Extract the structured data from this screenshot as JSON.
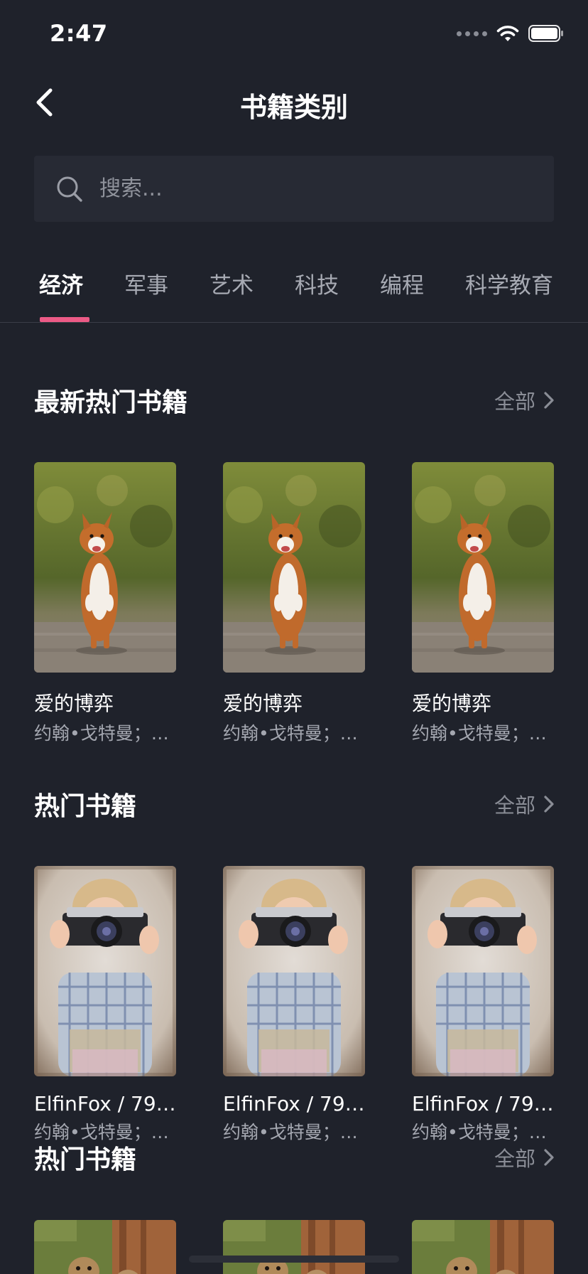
{
  "status_bar": {
    "time": "2:47"
  },
  "header": {
    "title": "书籍类别"
  },
  "search": {
    "placeholder": "搜索..."
  },
  "tabs": [
    {
      "label": "经济",
      "active": true
    },
    {
      "label": "军事",
      "active": false
    },
    {
      "label": "艺术",
      "active": false
    },
    {
      "label": "科技",
      "active": false
    },
    {
      "label": "编程",
      "active": false
    },
    {
      "label": "科学教育",
      "active": false
    }
  ],
  "sections": [
    {
      "title": "最新热门书籍",
      "see_all": "全部",
      "books": [
        {
          "title": "爱的博弈",
          "author": "约翰•戈特曼；娜...",
          "cover": "corgi-photo"
        },
        {
          "title": "爱的博弈",
          "author": "约翰•戈特曼；娜...",
          "cover": "corgi-photo"
        },
        {
          "title": "爱的博弈",
          "author": "约翰•戈特曼；娜...",
          "cover": "corgi-photo"
        }
      ]
    },
    {
      "title": "热门书籍",
      "see_all": "全部",
      "books": [
        {
          "title": "ElfinFox / 79 ...",
          "author": "约翰•戈特曼；娜...",
          "cover": "child-camera-photo"
        },
        {
          "title": "ElfinFox / 79 ...",
          "author": "约翰•戈特曼；娜...",
          "cover": "child-camera-photo"
        },
        {
          "title": "ElfinFox / 79 ...",
          "author": "约翰•戈特曼；娜...",
          "cover": "child-camera-photo"
        }
      ]
    },
    {
      "title": "热门书籍",
      "see_all": "全部",
      "books": [
        {
          "cover": "meerkat-photo"
        },
        {
          "cover": "meerkat-photo"
        },
        {
          "cover": "meerkat-photo"
        }
      ]
    }
  ],
  "colors": {
    "background": "#1f222b",
    "search_bg": "#272a34",
    "accent": "#ec5a86",
    "muted_text": "#a4a7b0"
  }
}
